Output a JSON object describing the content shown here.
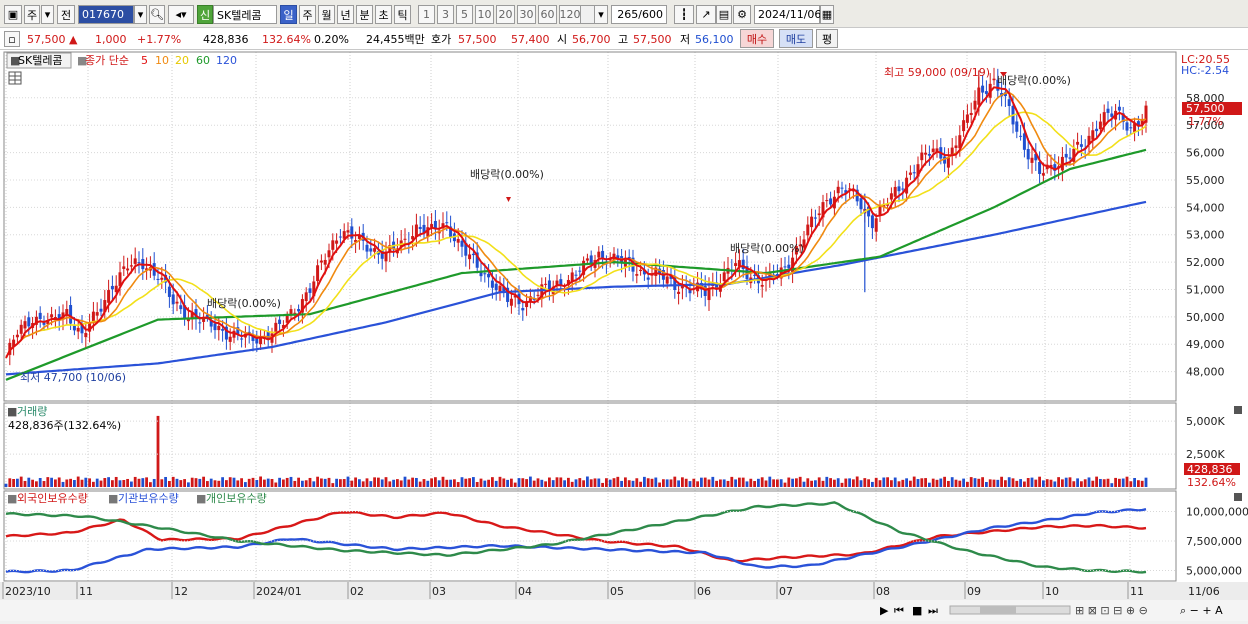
{
  "toolbar": {
    "period_kind": "주",
    "prev_label": "전",
    "code": "017670",
    "new_badge": "신",
    "stock_name": "SK텔레콤",
    "periods": [
      "일",
      "주",
      "월",
      "년",
      "분",
      "초",
      "틱"
    ],
    "active_period": "일",
    "ticks": [
      "1",
      "3",
      "5",
      "10",
      "20",
      "30",
      "60",
      "120"
    ],
    "count": "265",
    "count_total": "/600",
    "date": "2024/11/06"
  },
  "quote": {
    "price": "57,500",
    "change": "1,000",
    "rate": "+1.77%",
    "volume": "428,836",
    "vol_ratio": "132.64%",
    "turnover": "0.20%",
    "amount": "24,455백만",
    "ask_label": "호가",
    "ask1": "57,500",
    "ask2": "57,400",
    "open_label": "시",
    "open": "56,700",
    "high_label": "고",
    "high": "57,500",
    "low_label": "저",
    "low": "56,100",
    "buy_label": "매수",
    "sell_label": "매도",
    "eval_label": "평"
  },
  "colors": {
    "up": "#d01818",
    "down": "#1f4fd0",
    "ma5": "#e01010",
    "ma10": "#f08a10",
    "ma20": "#f2e01a",
    "ma60": "#1e9a2a",
    "ma120": "#2a52d8",
    "foreign": "#d81818",
    "inst": "#2a52d8",
    "indiv": "#2e8a4a"
  },
  "price_panel": {
    "legend_name": "SK텔레콤",
    "legend_ma": "종가 단순",
    "ma_periods": [
      "5",
      "10",
      "20",
      "60",
      "120"
    ],
    "lc": "LC:20.55",
    "hc": "HC:-2.54",
    "last_price": "57,500",
    "last_rate": "1.77%",
    "high_note": "최고 59,000 (09/19)",
    "low_note": "최저 47,700 (10/06)",
    "dividend_label": "배당락(0.00%)"
  },
  "volume_panel": {
    "title": "거래량",
    "value": "428,836주(132.64%)",
    "last": "428,836",
    "last_rate": "132.64%"
  },
  "holdings_panel": {
    "labels": [
      "외국인보유수량",
      "기관보유수량",
      "개인보유수량"
    ]
  },
  "x_labels": [
    "2023/10",
    "11",
    "12",
    "2024/01",
    "02",
    "03",
    "04",
    "05",
    "06",
    "07",
    "08",
    "09",
    "10",
    "11",
    "11/06"
  ],
  "chart_data": {
    "type": "line",
    "price_ylim": [
      47000,
      59600
    ],
    "price_yticks": [
      "48,000",
      "49,000",
      "50,000",
      "51,000",
      "52,000",
      "53,000",
      "54,000",
      "55,000",
      "56,000",
      "57,000",
      "58,000"
    ],
    "volume_yticks": [
      "2,500K",
      "5,000K"
    ],
    "holdings_yticks": [
      "5,000,000",
      "7,500,000",
      "10,000,000"
    ],
    "close_series": [
      [
        0,
        48500
      ],
      [
        3,
        49400
      ],
      [
        7,
        50000
      ],
      [
        12,
        49800
      ],
      [
        16,
        50200
      ],
      [
        20,
        49300
      ],
      [
        24,
        50100
      ],
      [
        28,
        51200
      ],
      [
        32,
        51800
      ],
      [
        36,
        52000
      ],
      [
        40,
        51500
      ],
      [
        44,
        50500
      ],
      [
        48,
        50100
      ],
      [
        52,
        49800
      ],
      [
        56,
        49600
      ],
      [
        60,
        49300
      ],
      [
        64,
        49200
      ],
      [
        68,
        49300
      ],
      [
        72,
        49600
      ],
      [
        76,
        50300
      ],
      [
        80,
        51000
      ],
      [
        84,
        52200
      ],
      [
        88,
        53200
      ],
      [
        92,
        52800
      ],
      [
        96,
        52500
      ],
      [
        100,
        52300
      ],
      [
        104,
        52600
      ],
      [
        108,
        53300
      ],
      [
        112,
        53100
      ],
      [
        116,
        53400
      ],
      [
        120,
        52500
      ],
      [
        124,
        51800
      ],
      [
        128,
        51300
      ],
      [
        132,
        50600
      ],
      [
        136,
        50500
      ],
      [
        140,
        50900
      ],
      [
        144,
        51100
      ],
      [
        148,
        51400
      ],
      [
        152,
        51800
      ],
      [
        156,
        52300
      ],
      [
        160,
        52100
      ],
      [
        164,
        51900
      ],
      [
        168,
        51600
      ],
      [
        172,
        51500
      ],
      [
        176,
        51200
      ],
      [
        180,
        51000
      ],
      [
        184,
        50900
      ],
      [
        188,
        51400
      ],
      [
        192,
        51900
      ],
      [
        196,
        51500
      ],
      [
        200,
        51300
      ],
      [
        204,
        51600
      ],
      [
        208,
        52500
      ],
      [
        212,
        53400
      ],
      [
        216,
        54300
      ],
      [
        220,
        54700
      ],
      [
        224,
        54300
      ],
      [
        228,
        53500
      ],
      [
        232,
        54200
      ],
      [
        236,
        54900
      ],
      [
        240,
        55600
      ],
      [
        244,
        56100
      ],
      [
        248,
        55800
      ],
      [
        252,
        56900
      ],
      [
        256,
        58300
      ],
      [
        260,
        58500
      ],
      [
        264,
        57600
      ],
      [
        268,
        56200
      ],
      [
        272,
        55200
      ],
      [
        276,
        55600
      ],
      [
        280,
        55900
      ],
      [
        284,
        56300
      ],
      [
        288,
        57300
      ],
      [
        292,
        57400
      ],
      [
        296,
        56900
      ],
      [
        300,
        57500
      ]
    ],
    "ma60_series": [
      [
        0,
        47700
      ],
      [
        40,
        49900
      ],
      [
        80,
        50100
      ],
      [
        120,
        51600
      ],
      [
        160,
        52000
      ],
      [
        200,
        51600
      ],
      [
        230,
        52200
      ],
      [
        260,
        54000
      ],
      [
        280,
        55400
      ],
      [
        300,
        56100
      ]
    ],
    "ma120_series": [
      [
        0,
        47900
      ],
      [
        40,
        48300
      ],
      [
        70,
        48900
      ],
      [
        100,
        49800
      ],
      [
        130,
        50900
      ],
      [
        160,
        51100
      ],
      [
        190,
        51200
      ],
      [
        220,
        51900
      ],
      [
        260,
        53000
      ],
      [
        300,
        54200
      ]
    ],
    "volume_spike_index": 40,
    "volume_last_index": 300
  }
}
